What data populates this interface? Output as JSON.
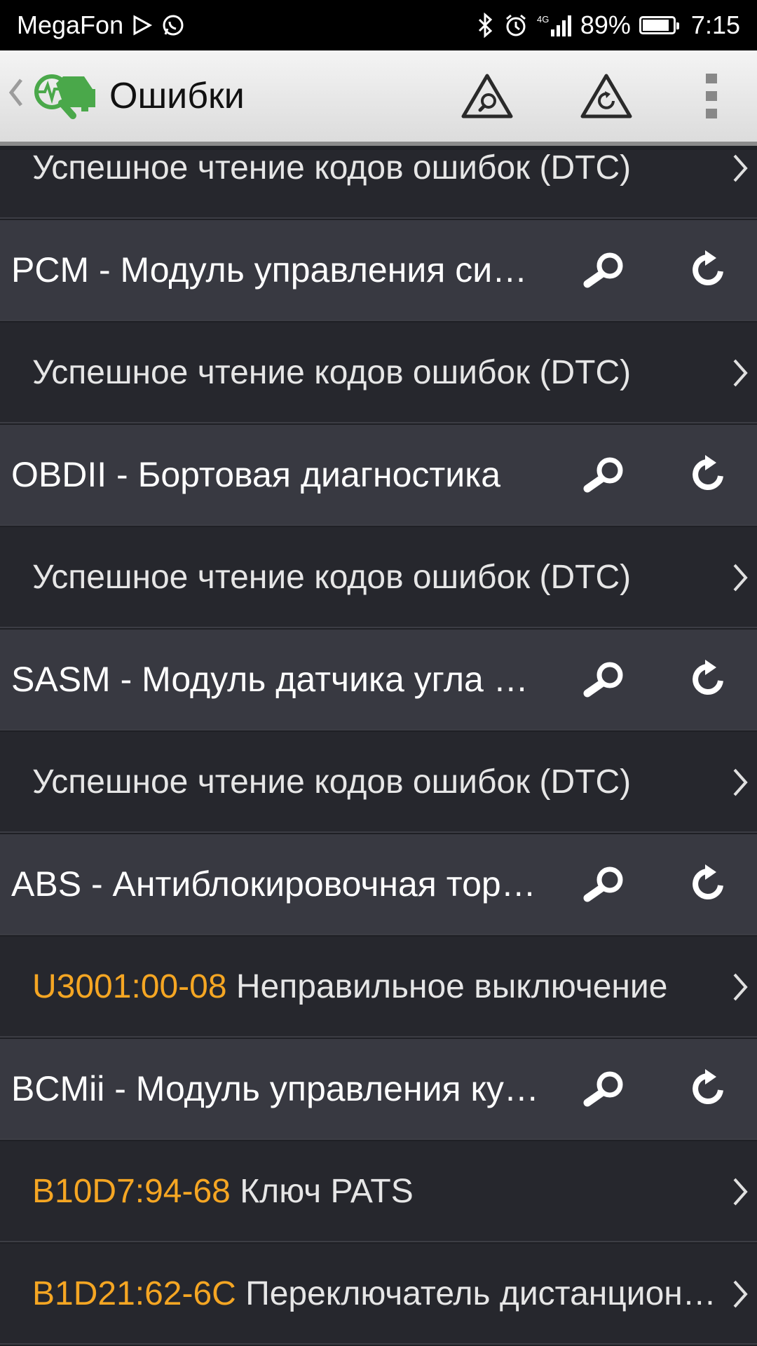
{
  "status_bar": {
    "carrier": "MegaFon",
    "battery_percent": "89%",
    "battery_level": 0.89,
    "time": "7:15",
    "network": "4G"
  },
  "toolbar": {
    "title": "Ошибки",
    "icons": [
      "back-chevron-icon",
      "app-logo-icon",
      "scan-warning-icon",
      "clear-warning-icon",
      "overflow-menu-icon"
    ]
  },
  "rows": [
    {
      "type": "sub",
      "text": "Успешное чтение кодов ошибок (DTC)"
    },
    {
      "type": "header",
      "text": "PCM - Модуль управления силовым агрегатом"
    },
    {
      "type": "sub",
      "text": "Успешное чтение кодов ошибок (DTC)"
    },
    {
      "type": "header",
      "text": "OBDII - Бортовая диагностика"
    },
    {
      "type": "sub",
      "text": "Успешное чтение кодов ошибок (DTC)"
    },
    {
      "type": "header",
      "text": "SASM - Модуль датчика угла поворота"
    },
    {
      "type": "sub",
      "text": "Успешное чтение кодов ошибок (DTC)"
    },
    {
      "type": "header",
      "text": "ABS - Антиблокировочная тормозная система"
    },
    {
      "type": "code",
      "code": "U3001:00-08",
      "text": "Неправильное выключение"
    },
    {
      "type": "header",
      "text": "BCMii - Модуль управления кузовом"
    },
    {
      "type": "code",
      "code": "B10D7:94-68",
      "text": "Ключ PATS"
    },
    {
      "type": "code",
      "code": "B1D21:62-6C",
      "text": "Переключатель дистанционного"
    }
  ],
  "colors": {
    "header_bg": "#383941",
    "sub_bg": "#26272d",
    "code_color": "#f5a623",
    "accent_green": "#3fae3f"
  }
}
